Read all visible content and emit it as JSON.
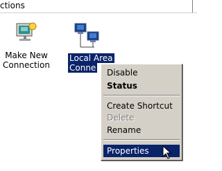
{
  "window": {
    "title_fragment": "ctions"
  },
  "desktop": {
    "icons": [
      {
        "label_line1": "Make New",
        "label_line2": "Connection",
        "icon": "make-new-connection-icon"
      },
      {
        "label_line1": "Local Area",
        "label_line2": "Conne",
        "icon": "local-area-connection-icon",
        "selected": true
      }
    ]
  },
  "context_menu": {
    "items": [
      {
        "label": "Disable"
      },
      {
        "label": "Status",
        "style": "bold"
      },
      {
        "label": "Create Shortcut"
      },
      {
        "label": "Delete",
        "disabled": true
      },
      {
        "label": "Rename"
      },
      {
        "label": "Properties",
        "selected": true
      }
    ]
  },
  "colors": {
    "selection": "#0a246a",
    "menu_bg": "#d4d0c8",
    "text": "#000000"
  },
  "cursor_icon": "arrow-pointer-icon"
}
